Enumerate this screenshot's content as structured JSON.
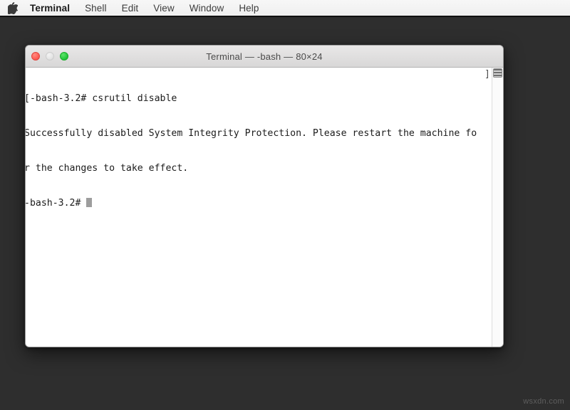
{
  "desktop": {
    "background_color": "#2e2e2e",
    "watermark": "wsxdn.com"
  },
  "menubar": {
    "background_color": "#f2f2f2",
    "apple_icon": "apple-logo-icon",
    "items": [
      {
        "label": "Terminal",
        "active": true
      },
      {
        "label": "Shell",
        "active": false
      },
      {
        "label": "Edit",
        "active": false
      },
      {
        "label": "View",
        "active": false
      },
      {
        "label": "Window",
        "active": false
      },
      {
        "label": "Help",
        "active": false
      }
    ]
  },
  "window": {
    "title": "Terminal — -bash — 80×24",
    "controls": {
      "close": "close-button",
      "minimize": "minimize-button",
      "zoom": "zoom-button"
    },
    "scrollbar": {
      "thumb_position": "top",
      "artifact_glyph": "]"
    }
  },
  "terminal": {
    "prompt_symbol": "-bash-3.2#",
    "lines": [
      "[-bash-3.2# csrutil disable",
      "Successfully disabled System Integrity Protection. Please restart the machine fo",
      "r the changes to take effect."
    ],
    "current_prompt": "-bash-3.2# ",
    "cursor_visible": true,
    "columns": 80,
    "rows": 24
  }
}
